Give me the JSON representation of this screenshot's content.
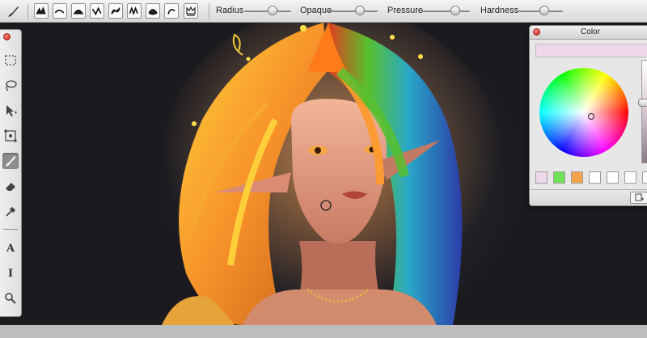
{
  "toolbar": {
    "sliders": [
      {
        "label": "Radius",
        "value": 0.6
      },
      {
        "label": "Opaque",
        "value": 0.63
      },
      {
        "label": "Pressure",
        "value": 0.7
      },
      {
        "label": "Hardness",
        "value": 0.6
      }
    ],
    "brush_presets": [
      "brush-preset-1",
      "brush-preset-2",
      "brush-preset-3",
      "brush-preset-4",
      "brush-preset-5",
      "brush-preset-6",
      "brush-preset-7",
      "brush-preset-8"
    ]
  },
  "tools": [
    {
      "name": "rect-select-tool",
      "icon": "dashed-rect-icon"
    },
    {
      "name": "lasso-tool",
      "icon": "lasso-icon"
    },
    {
      "name": "move-tool",
      "icon": "move-arrow-icon"
    },
    {
      "name": "transform-tool",
      "icon": "transform-icon"
    },
    {
      "name": "brush-tool",
      "icon": "brush-icon",
      "active": true
    },
    {
      "name": "eraser-tool",
      "icon": "eraser-icon"
    },
    {
      "name": "eyedropper-tool",
      "icon": "eyedropper-icon"
    },
    {
      "name": "text-tool",
      "label": "A"
    },
    {
      "name": "text-cursor-tool",
      "label": "I"
    },
    {
      "name": "zoom-tool",
      "icon": "magnifier-icon"
    }
  ],
  "color_panel": {
    "title": "Color",
    "current_color": "#efd8ea",
    "swatches": [
      "#efd8ea",
      "#6fe05a",
      "#f5a34a",
      "#ffffff",
      "#ffffff",
      "#ffffff",
      "#ffffff"
    ]
  }
}
